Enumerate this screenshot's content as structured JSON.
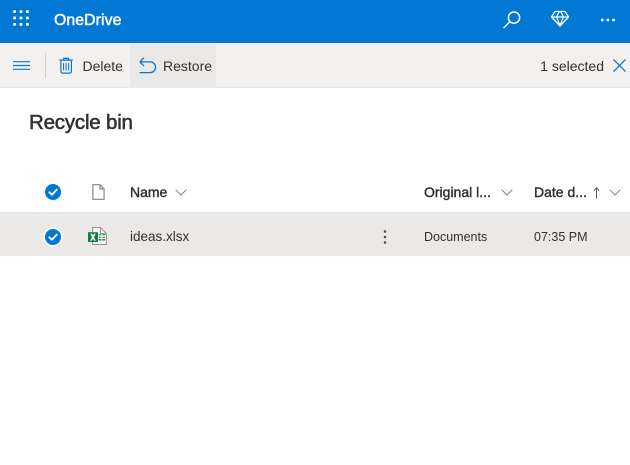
{
  "colors": {
    "brand_blue": "#0078d4",
    "command_icon_blue": "#0778cf",
    "toolbar_bg": "#f2f1ef",
    "active_button_bg": "#ebe9e7",
    "selected_row_bg": "#ebe9e7",
    "text_dark": "#323130",
    "icon_gray": "#8a8886",
    "excel_green": "#107c41"
  },
  "topbar": {
    "app_name": "OneDrive",
    "icons": [
      "app-launcher",
      "search",
      "premium",
      "more"
    ]
  },
  "command_bar": {
    "delete_label": "Delete",
    "restore_label": "Restore",
    "selection_count": "1 selected"
  },
  "page": {
    "title": "Recycle bin"
  },
  "table": {
    "columns": [
      {
        "key": "name",
        "label": "Name",
        "sortable": true
      },
      {
        "key": "original_location",
        "label": "Original l...",
        "sortable": true
      },
      {
        "key": "date_deleted",
        "label": "Date d...",
        "sortable": true,
        "sort": "ascending"
      }
    ],
    "rows": [
      {
        "name": "ideas.xlsx",
        "file_type": "xlsx",
        "original_location": "Documents",
        "date_deleted": "07:35 PM",
        "selected": true
      }
    ]
  }
}
